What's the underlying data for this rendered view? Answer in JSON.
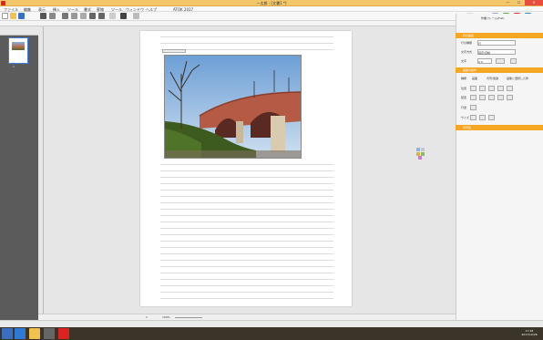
{
  "window": {
    "title": "一太郎 - [文書1 *]",
    "min": "—",
    "max": "☐",
    "close": "✕"
  },
  "menu": [
    "ファイル",
    "編集",
    "表示",
    "挿入",
    "ツール",
    "書式",
    "罫線",
    "ツール",
    "ウィンドウ",
    "ヘルプ",
    "ATOK 2017"
  ],
  "statusbar": {
    "page": "1",
    "zoom": "100%"
  },
  "rightpanel": {
    "header": "作業フレーム(Full)",
    "section1": {
      "title": "行の編集",
      "label1": "行の種類",
      "value1": "行",
      "label2": "文字方式",
      "value2": "固定/自動",
      "label3": "文字",
      "value3": "2.0"
    },
    "section2": {
      "title": "画像の操作",
      "label1": "種類",
      "opt1": "画面",
      "opt2": "背景/透過",
      "opt3": "画像と選択した枠",
      "label2": "位置",
      "label3": "配置",
      "label4": "行送",
      "label5": "サイズ"
    },
    "section3": {
      "title": "背景色"
    }
  },
  "leftpane": {
    "page_num": "1"
  },
  "clock": {
    "time": "17:18",
    "date": "2017/12/26"
  }
}
